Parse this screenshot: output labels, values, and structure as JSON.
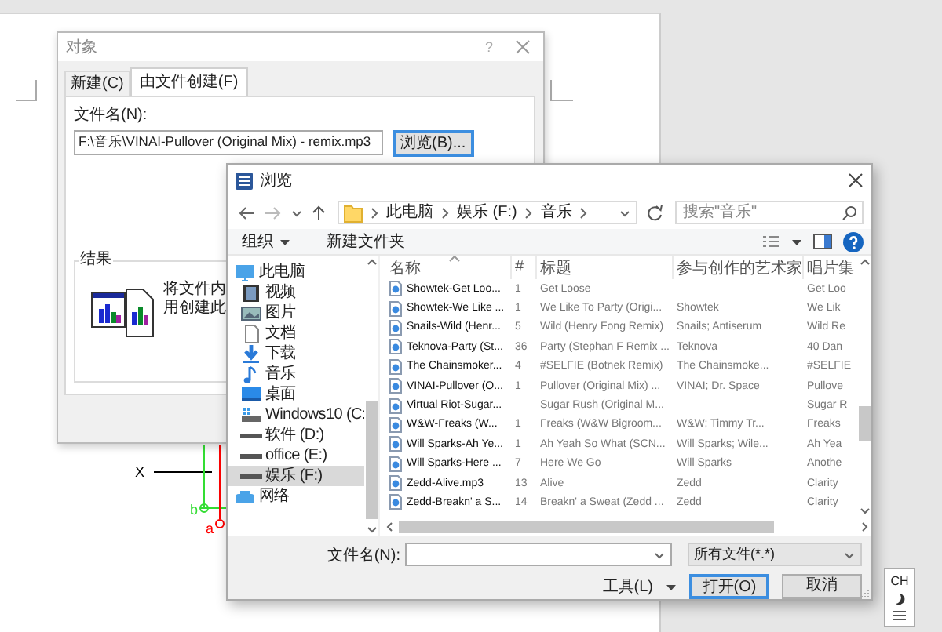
{
  "document": {
    "labels": [
      {
        "text": "X",
        "color": "#000000"
      },
      {
        "text": "b",
        "color": "#33dd33"
      },
      {
        "text": "a",
        "color": "#ff0000"
      }
    ]
  },
  "object_dialog": {
    "title": "对象",
    "help": "?",
    "tabs": [
      {
        "label": "新建(C)",
        "selected": false
      },
      {
        "label": "由文件创建(F)",
        "selected": true
      }
    ],
    "file_name_label": "文件名(N):",
    "file_name_value": "F:\\音乐\\VINAI-Pullover (Original Mix) - remix.mp3",
    "browse_button": {
      "label": "浏览(B)...",
      "default": true
    },
    "result_label": "结果",
    "result_lines": [
      "将文件内",
      "用创建此"
    ]
  },
  "browse_dialog": {
    "title": "浏览",
    "breadcrumb": [
      "此电脑",
      "娱乐 (F:)",
      "音乐"
    ],
    "search_placeholder": "搜索\"音乐\"",
    "organize": "组织",
    "new_folder": "新建文件夹",
    "nav": [
      {
        "label": "此电脑",
        "kind": "computer",
        "selected": false,
        "children": [
          {
            "label": "视频",
            "kind": "video",
            "selected": false
          },
          {
            "label": "图片",
            "kind": "picture",
            "selected": false
          },
          {
            "label": "文档",
            "kind": "document",
            "selected": false
          },
          {
            "label": "下载",
            "kind": "download",
            "selected": false
          },
          {
            "label": "音乐",
            "kind": "music",
            "selected": false
          },
          {
            "label": "桌面",
            "kind": "desktop",
            "selected": false
          },
          {
            "label": "Windows10 (C:",
            "kind": "system-drive",
            "selected": false
          },
          {
            "label": "软件 (D:)",
            "kind": "drive",
            "selected": false
          },
          {
            "label": "office (E:)",
            "kind": "drive",
            "selected": false
          },
          {
            "label": "娱乐 (F:)",
            "kind": "drive",
            "selected": true
          }
        ]
      },
      {
        "label": "网络",
        "kind": "network",
        "selected": false
      }
    ],
    "columns": [
      {
        "label": "名称",
        "sorted": true
      },
      {
        "label": "#",
        "sorted": false
      },
      {
        "label": "标题",
        "sorted": false
      },
      {
        "label": "参与创作的艺术家",
        "sorted": false
      },
      {
        "label": "唱片集",
        "sorted": false
      }
    ],
    "rows": [
      {
        "name": "Showtek-Get Loo...",
        "number": "1",
        "title": "Get Loose",
        "album": "Get Loo"
      },
      {
        "name": "Showtek-We Like ...",
        "number": "1",
        "title": "We Like To Party (Origi...",
        "artists": "Showtek",
        "album": "We Lik"
      },
      {
        "name": "Snails-Wild (Henr...",
        "number": "5",
        "title": "Wild (Henry Fong Remix)",
        "artists": "Snails; Antiserum",
        "album": "Wild Re"
      },
      {
        "name": "Teknova-Party (St...",
        "number": "36",
        "title": "Party (Stephan F Remix ...",
        "artists": "Teknova",
        "album": "40 Dan"
      },
      {
        "name": "The Chainsmoker...",
        "number": "4",
        "title": "#SELFIE (Botnek Remix)",
        "artists": "The Chainsmoke...",
        "album": "#SELFIE"
      },
      {
        "name": "VINAI-Pullover (O...",
        "number": "1",
        "title": "Pullover (Original Mix) ...",
        "artists": "VINAI; Dr. Space",
        "album": "Pullove"
      },
      {
        "name": "Virtual Riot-Sugar...",
        "title": "Sugar Rush (Original M...",
        "album": "Sugar R"
      },
      {
        "name": "W&W-Freaks (W...",
        "number": "1",
        "title": "Freaks (W&W Bigroom...",
        "artists": "W&W; Timmy Tr...",
        "album": "Freaks"
      },
      {
        "name": "Will Sparks-Ah Ye...",
        "number": "1",
        "title": "Ah Yeah So What (SCN...",
        "artists": "Will Sparks; Wile...",
        "album": "Ah Yea"
      },
      {
        "name": "Will Sparks-Here ...",
        "number": "7",
        "title": "Here We Go",
        "artists": "Will Sparks",
        "album": "Anothe"
      },
      {
        "name": "Zedd-Alive.mp3",
        "number": "13",
        "title": "Alive",
        "artists": "Zedd",
        "album": "Clarity"
      },
      {
        "name": "Zedd-Breakn' a S...",
        "number": "14",
        "title": "Breakn' a Sweat (Zedd ...",
        "artists": "Zedd",
        "album": "Clarity"
      }
    ],
    "file_name_label": "文件名(N):",
    "file_type": "所有文件(*.*)",
    "tools": "工具(L)",
    "open_button": {
      "label": "打开(O)",
      "default": true
    },
    "cancel_button": {
      "label": "取消",
      "default": false
    }
  },
  "ime": {
    "language": "CH"
  }
}
